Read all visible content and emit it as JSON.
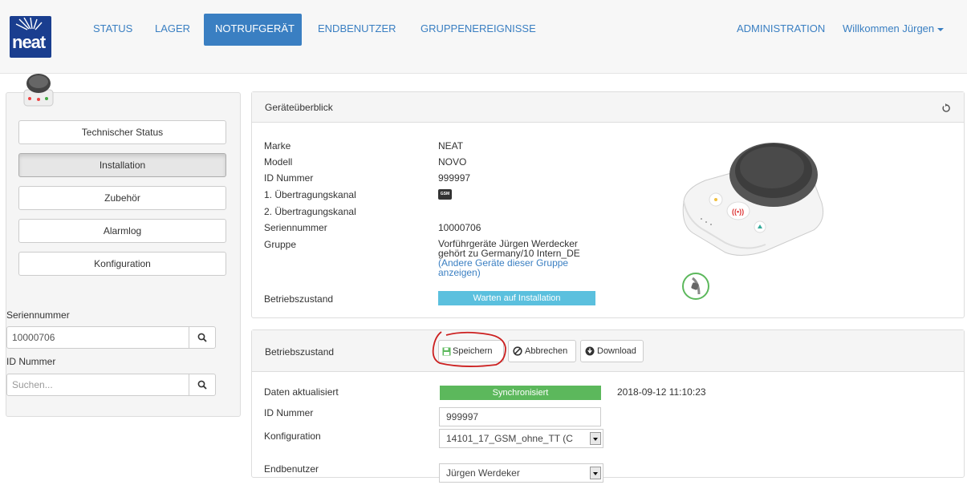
{
  "nav": {
    "items": [
      {
        "label": "STATUS"
      },
      {
        "label": "LAGER"
      },
      {
        "label": "NOTRUFGERÄT"
      },
      {
        "label": "ENDBENUTZER"
      },
      {
        "label": "GRUPPENEREIGNISSE"
      }
    ],
    "admin": "ADMINISTRATION",
    "welcome": "Willkommen Jürgen",
    "logo_text": "neat"
  },
  "sidebar": {
    "buttons": [
      {
        "label": "Technischer Status"
      },
      {
        "label": "Installation"
      },
      {
        "label": "Zubehör"
      },
      {
        "label": "Alarmlog"
      },
      {
        "label": "Konfiguration"
      }
    ],
    "serial_label": "Seriennummer",
    "serial_value": "10000706",
    "id_label": "ID Nummer",
    "id_placeholder": "Suchen..."
  },
  "overview": {
    "title": "Geräteüberblick",
    "rows": [
      {
        "key": "Marke",
        "value": "NEAT"
      },
      {
        "key": "Modell",
        "value": "NOVO"
      },
      {
        "key": "ID Nummer",
        "value": "999997"
      },
      {
        "key": "1. Übertragungskanal",
        "value": ""
      },
      {
        "key": "2. Übertragungskanal",
        "value": ""
      },
      {
        "key": "Seriennummer",
        "value": "10000706"
      },
      {
        "key": "Gruppe",
        "value": "Vorführgeräte Jürgen Werdecker"
      }
    ],
    "gsm_badge": "GSM",
    "group_line2": "gehört zu Germany/10 Intern_DE",
    "group_link": "(Andere Geräte dieser Gruppe anzeigen)",
    "state_label": "Betriebszustand",
    "state_value": "Warten auf Installation",
    "colors": {
      "info": "#5bc0de",
      "success": "#5cb85c",
      "primary": "#3a7fc2"
    }
  },
  "operation": {
    "title": "Betriebszustand",
    "save": "Speichern",
    "cancel": "Abbrechen",
    "download": "Download",
    "rows": [
      {
        "key": "Daten aktualisiert"
      },
      {
        "key": "ID Nummer"
      },
      {
        "key": "Konfiguration"
      },
      {
        "key": "Endbenutzer"
      }
    ],
    "sync_status": "Synchronisiert",
    "timestamp": "2018-09-12 11:10:23",
    "id_value": "999997",
    "config_value": "14101_17_GSM_ohne_TT (C",
    "enduser_value": "Jürgen Werdeker"
  }
}
